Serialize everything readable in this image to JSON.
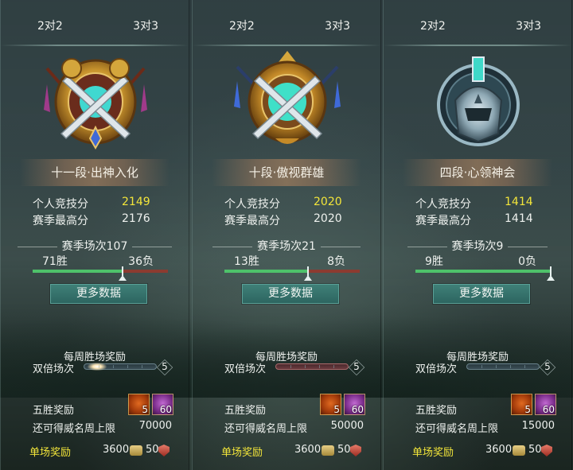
{
  "panels": [
    {
      "tabs": [
        "2对2",
        "3对3"
      ],
      "rank_title": "十一段·出神入化",
      "personal_label": "个人竞技分",
      "personal_value": "2149",
      "season_high_label": "赛季最高分",
      "season_high_value": "2176",
      "season_matches": "赛季场次107",
      "wins": "71胜",
      "losses": "36负",
      "win_ratio": 0.664,
      "more_button": "更多数据",
      "weekly_title": "每周胜场奖励",
      "double_label": "双倍场次",
      "double_count": "5",
      "five_win_label": "五胜奖励",
      "item1_count": "5",
      "item2_count": "60",
      "limit_label": "还可得威名周上限",
      "limit_value": "70000",
      "single_label": "单场奖励",
      "single_value1": "3600",
      "single_value2": "50"
    },
    {
      "tabs": [
        "2对2",
        "3对3"
      ],
      "rank_title": "十段·傲视群雄",
      "personal_label": "个人竞技分",
      "personal_value": "2020",
      "season_high_label": "赛季最高分",
      "season_high_value": "2020",
      "season_matches": "赛季场次21",
      "wins": "13胜",
      "losses": "8负",
      "win_ratio": 0.619,
      "more_button": "更多数据",
      "weekly_title": "每周胜场奖励",
      "double_label": "双倍场次",
      "double_count": "5",
      "five_win_label": "五胜奖励",
      "item1_count": "5",
      "item2_count": "60",
      "limit_label": "还可得威名周上限",
      "limit_value": "50000",
      "single_label": "单场奖励",
      "single_value1": "3600",
      "single_value2": "50"
    },
    {
      "tabs": [
        "2对2",
        "3对3"
      ],
      "rank_title": "四段·心领神会",
      "personal_label": "个人竞技分",
      "personal_value": "1414",
      "season_high_label": "赛季最高分",
      "season_high_value": "1414",
      "season_matches": "赛季场次9",
      "wins": "9胜",
      "losses": "0负",
      "win_ratio": 1.0,
      "more_button": "更多数据",
      "weekly_title": "每周胜场奖励",
      "double_label": "双倍场次",
      "double_count": "5",
      "five_win_label": "五胜奖励",
      "item1_count": "5",
      "item2_count": "60",
      "limit_label": "还可得威名周上限",
      "limit_value": "15000",
      "single_label": "单场奖励",
      "single_value1": "3600",
      "single_value2": "50"
    }
  ],
  "colors": {
    "highlight": "#f2e53a",
    "win_bar": "#4ec26a",
    "loss_bar": "#8c3b30",
    "button": "#3f8078"
  },
  "icons": {
    "emblem_1": "crossed-swords-gold-emblem-icon",
    "emblem_2": "crossed-swords-cyan-emblem-icon",
    "emblem_3": "silver-helmet-emblem-icon",
    "item_1": "treasure-chest-icon",
    "item_2": "purple-potion-icon",
    "currency_1": "coin-icon",
    "currency_2": "shield-badge-icon"
  }
}
